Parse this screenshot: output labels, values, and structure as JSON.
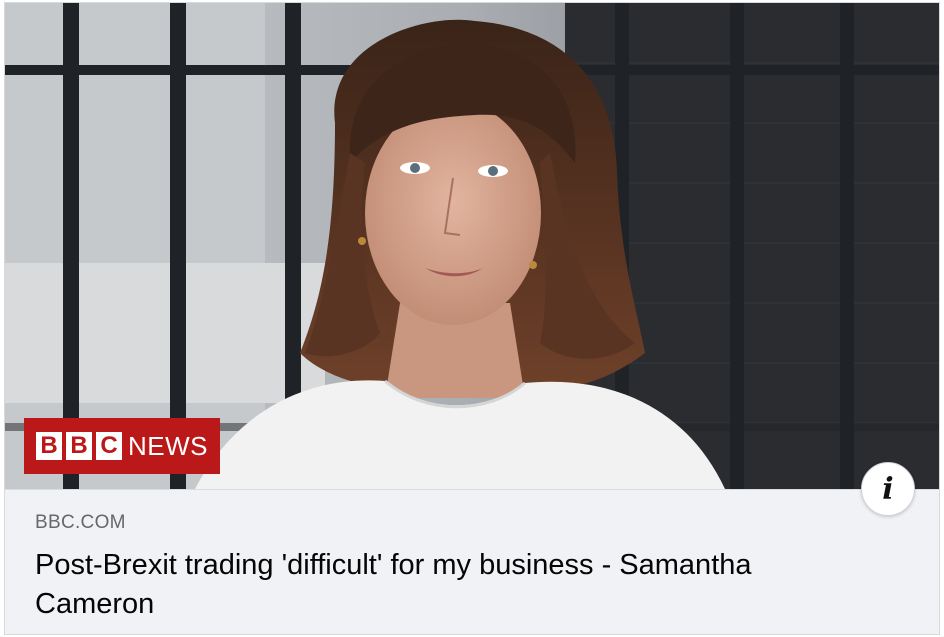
{
  "link_card": {
    "source_logo": {
      "letters": [
        "B",
        "B",
        "C"
      ],
      "word": "NEWS"
    },
    "info_icon": "i",
    "domain": "BBC.COM",
    "headline": "Post-Brexit trading 'difficult' for my business - Samantha Cameron"
  },
  "colors": {
    "bbc_red": "#bb1919",
    "card_footer": "#f0f2f5",
    "domain_text": "#65676b",
    "headline_text": "#050505"
  }
}
